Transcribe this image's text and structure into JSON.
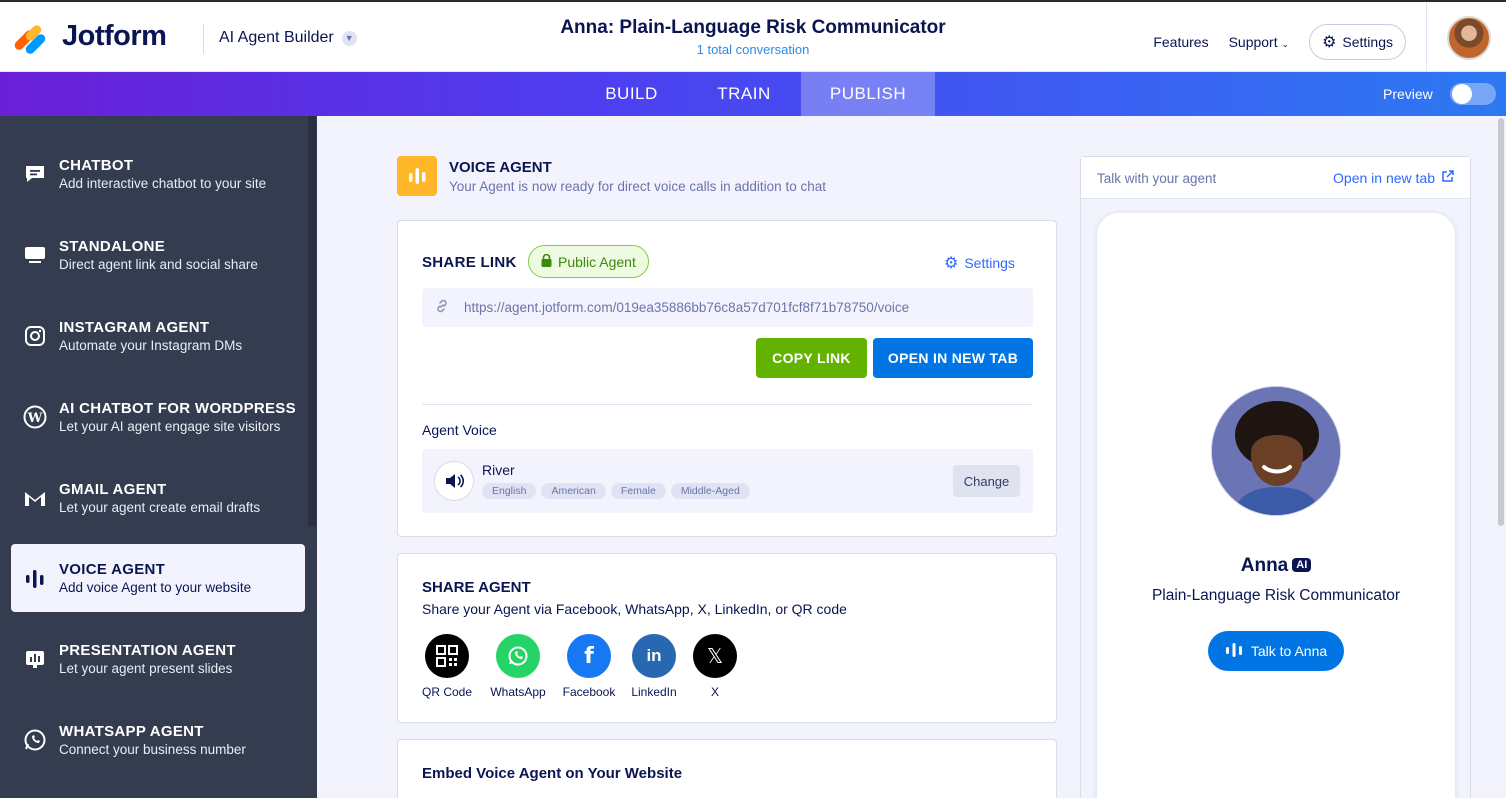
{
  "header": {
    "logo_text": "Jotform",
    "builder_label": "AI Agent Builder",
    "title": "Anna: Plain-Language Risk Communicator",
    "subtitle": "1 total conversation",
    "nav": {
      "features": "Features",
      "support": "Support",
      "settings": "Settings"
    }
  },
  "tabs": [
    {
      "label": "BUILD",
      "active": false
    },
    {
      "label": "TRAIN",
      "active": false
    },
    {
      "label": "PUBLISH",
      "active": true
    }
  ],
  "preview_label": "Preview",
  "sidebar": {
    "items": [
      {
        "title": "CHATBOT",
        "desc": "Add interactive chatbot to your site",
        "icon": "chat-icon"
      },
      {
        "title": "STANDALONE",
        "desc": "Direct agent link and social share",
        "icon": "monitor-icon"
      },
      {
        "title": "INSTAGRAM AGENT",
        "desc": "Automate your Instagram DMs",
        "icon": "instagram-icon"
      },
      {
        "title": "AI CHATBOT FOR WORDPRESS",
        "desc": "Let your AI agent engage site visitors",
        "icon": "wordpress-icon"
      },
      {
        "title": "GMAIL AGENT",
        "desc": "Let your agent create email drafts",
        "icon": "gmail-icon"
      },
      {
        "title": "VOICE AGENT",
        "desc": "Add voice Agent to your website",
        "icon": "voice-icon",
        "active": true
      },
      {
        "title": "PRESENTATION AGENT",
        "desc": "Let your agent present slides",
        "icon": "presentation-icon"
      },
      {
        "title": "WHATSAPP AGENT",
        "desc": "Connect your business number",
        "icon": "whatsapp-icon"
      }
    ]
  },
  "voice_agent": {
    "title": "VOICE AGENT",
    "subtitle": "Your Agent is now ready for direct voice calls in addition to chat"
  },
  "share_link": {
    "label": "SHARE LINK",
    "badge": "Public Agent",
    "settings": "Settings",
    "url": "https://agent.jotform.com/019ea35886bb76c8a57d701fcf8f71b78750/voice",
    "copy_btn": "COPY LINK",
    "open_btn": "OPEN IN NEW TAB",
    "agent_voice_label": "Agent Voice",
    "voice_name": "River",
    "voice_tags": [
      "English",
      "American",
      "Female",
      "Middle-Aged"
    ],
    "change_btn": "Change"
  },
  "share_agent": {
    "title": "SHARE AGENT",
    "subtitle": "Share your Agent via Facebook, WhatsApp, X, LinkedIn, or QR code",
    "options": [
      {
        "label": "QR Code",
        "color": "#000000"
      },
      {
        "label": "WhatsApp",
        "color": "#25d366"
      },
      {
        "label": "Facebook",
        "color": "#1877f2"
      },
      {
        "label": "LinkedIn",
        "color": "#2867b2"
      },
      {
        "label": "X",
        "color": "#000000"
      }
    ]
  },
  "embed": {
    "title": "Embed Voice Agent on Your Website"
  },
  "preview_panel": {
    "talk_label": "Talk with your agent",
    "open_new_tab": "Open in new tab",
    "agent_name": "Anna",
    "ai_badge": "AI",
    "agent_role": "Plain-Language Risk Communicator",
    "talk_btn": "Talk to Anna"
  }
}
